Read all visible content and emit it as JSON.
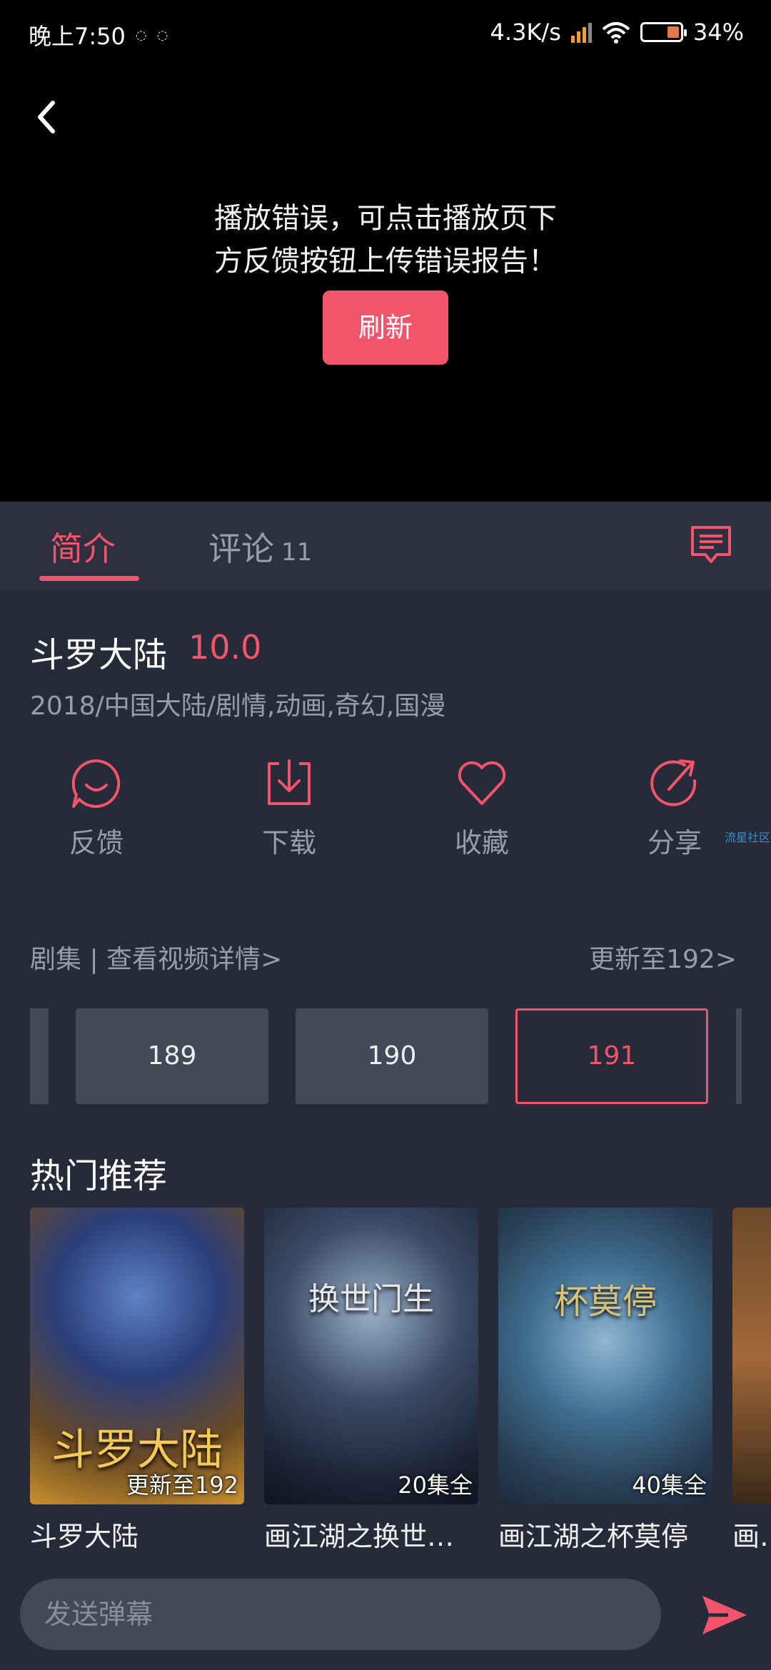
{
  "status_bar": {
    "time": "晚上7:50",
    "speed": "4.3K/s",
    "battery": "34%",
    "battery_level": 0.34
  },
  "player": {
    "error_line1": "播放错误，可点击播放页下",
    "error_line2": "方反馈按钮上传错误报告！",
    "refresh_label": "刷新"
  },
  "tabs": {
    "intro": "简介",
    "comments": "评论",
    "comments_count": "11"
  },
  "show": {
    "title": "斗罗大陆",
    "score": "10.0",
    "meta": "2018/中国大陆/剧情,动画,奇幻,国漫"
  },
  "actions": [
    {
      "label": "反馈",
      "icon": "feedback-smile-icon"
    },
    {
      "label": "下载",
      "icon": "download-icon"
    },
    {
      "label": "收藏",
      "icon": "heart-icon"
    },
    {
      "label": "分享",
      "icon": "share-icon"
    }
  ],
  "watermark": "流星社区",
  "episodes": {
    "header": "剧集 | 查看视频详情>",
    "update": "更新至192>",
    "items": [
      "189",
      "190",
      "191"
    ],
    "active": "191"
  },
  "recommend": {
    "title": "热门推荐",
    "items": [
      {
        "name": "斗罗大陆",
        "badge": "更新至192",
        "art": "斗罗大陆"
      },
      {
        "name": "画江湖之换世门...",
        "badge": "20集全",
        "art": "换世门生"
      },
      {
        "name": "画江湖之杯莫停",
        "badge": "40集全",
        "art": "杯莫停"
      },
      {
        "name": "画江",
        "badge": "",
        "art": ""
      }
    ]
  },
  "danmaku": {
    "placeholder": "发送弹幕"
  },
  "colors": {
    "accent": "#f2546b",
    "background": "#272a38",
    "muted_text": "#9a9cab"
  }
}
